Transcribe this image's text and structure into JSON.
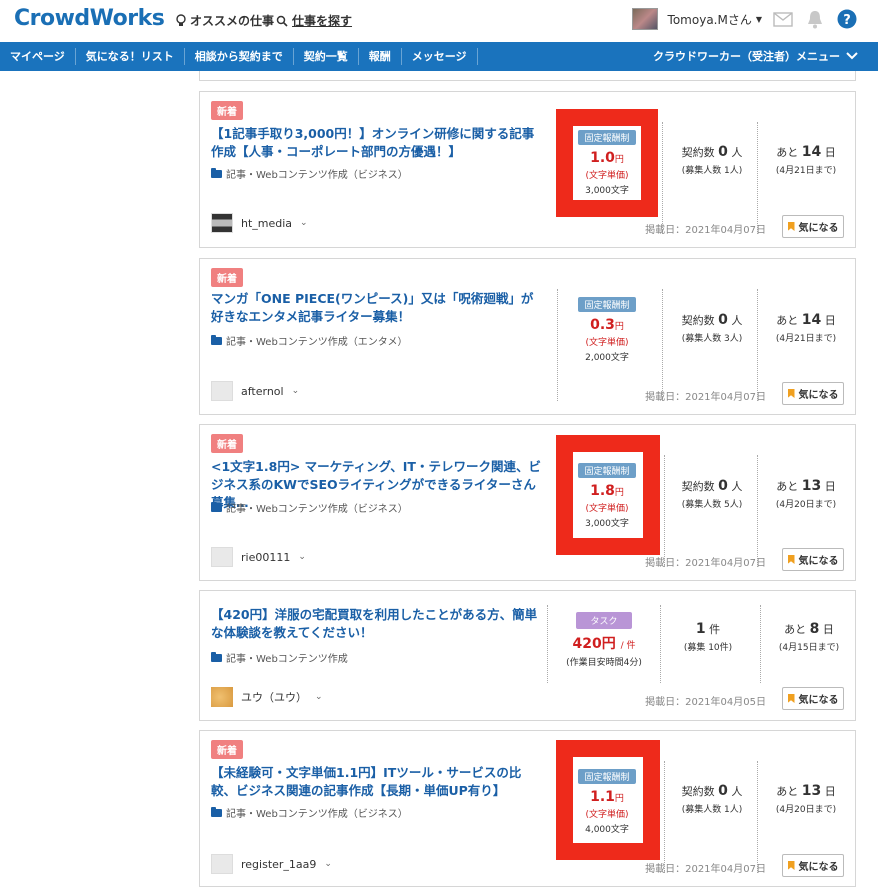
{
  "header": {
    "logo": "CrowdWorks",
    "recommend_label": "オススメの仕事",
    "search_label": "仕事を探す",
    "user_name": "Tomoya.Mさん",
    "icons": [
      "lightbulb-icon",
      "search-icon",
      "mail-icon",
      "bell-icon",
      "help-icon"
    ],
    "help_char": "?"
  },
  "nav": {
    "items": [
      "マイページ",
      "気になる！リスト",
      "相談から契約まで",
      "契約一覧",
      "報酬",
      "メッセージ"
    ],
    "menu_label": "クラウドワーカー（受注者）メニュー"
  },
  "colors": {
    "brand": "#1a6fb5",
    "nav_bg": "#1a73bd",
    "price_red": "#d01f1f",
    "highlight_red": "#ee2a1b",
    "new_badge": "#f08080"
  },
  "jobs": [
    {
      "badge": "新着",
      "title": "【1記事手取り3,000円！】オンライン研修に関する記事作成【人事・コーポレート部門の方優遇！】",
      "category": "記事・Webコンテンツ作成（ビジネス）",
      "client": "ht_media",
      "tag": "固定報酬制",
      "price": "1.0",
      "price_unit": "円",
      "unit_note": "(文字単価)",
      "chars": "3,000文字",
      "contracts_label": "契約数",
      "contracts": "0",
      "contracts_unit": "人",
      "recruit": "(募集人数 1人)",
      "remaining_label": "あと",
      "remaining": "14",
      "remaining_unit": "日",
      "deadline": "(4月21日まで)",
      "posted": "掲載日：2021年04月07日",
      "fav": "気になる"
    },
    {
      "badge": "新着",
      "title": "マンガ「ONE PIECE(ワンピース)」又は「呪術廻戦」が好きなエンタメ記事ライター募集！",
      "category": "記事・Webコンテンツ作成（エンタメ）",
      "client": "afternol",
      "tag": "固定報酬制",
      "price": "0.3",
      "price_unit": "円",
      "unit_note": "(文字単価)",
      "chars": "2,000文字",
      "contracts_label": "契約数",
      "contracts": "0",
      "contracts_unit": "人",
      "recruit": "(募集人数 3人)",
      "remaining_label": "あと",
      "remaining": "14",
      "remaining_unit": "日",
      "deadline": "(4月21日まで)",
      "posted": "掲載日：2021年04月07日",
      "fav": "気になる"
    },
    {
      "badge": "新着",
      "title": "<1文字1.8円> マーケティング、IT・テレワーク関連、ビジネス系のKWでSEOライティングができるライターさん募集…",
      "category": "記事・Webコンテンツ作成（ビジネス）",
      "client": "rie00111",
      "tag": "固定報酬制",
      "price": "1.8",
      "price_unit": "円",
      "unit_note": "(文字単価)",
      "chars": "3,000文字",
      "contracts_label": "契約数",
      "contracts": "0",
      "contracts_unit": "人",
      "recruit": "(募集人数 5人)",
      "remaining_label": "あと",
      "remaining": "13",
      "remaining_unit": "日",
      "deadline": "(4月20日まで)",
      "posted": "掲載日：2021年04月07日",
      "fav": "気になる"
    },
    {
      "title": "【420円】洋服の宅配買取を利用したことがある方、簡単な体験談を教えてください！",
      "category": "記事・Webコンテンツ作成",
      "client": "ユウ（ユウ）",
      "tag": "タスク",
      "price": "420円",
      "price_per": "/ 件",
      "unit_note": "(作業目安時間4分)",
      "count": "1",
      "count_unit": "件",
      "recruit": "(募集 10件)",
      "remaining_label": "あと",
      "remaining": "8",
      "remaining_unit": "日",
      "deadline": "(4月15日まで)",
      "posted": "掲載日：2021年04月05日",
      "fav": "気になる"
    },
    {
      "badge": "新着",
      "title": "【未経験可・文字単価1.1円】ITツール・サービスの比較、ビジネス関連の記事作成【長期・単価UP有り】",
      "category": "記事・Webコンテンツ作成（ビジネス）",
      "client": "register_1aa9",
      "tag": "固定報酬制",
      "price": "1.1",
      "price_unit": "円",
      "unit_note": "(文字単価)",
      "chars": "4,000文字",
      "contracts_label": "契約数",
      "contracts": "0",
      "contracts_unit": "人",
      "recruit": "(募集人数 1人)",
      "remaining_label": "あと",
      "remaining": "13",
      "remaining_unit": "日",
      "deadline": "(4月20日まで)",
      "posted": "掲載日：2021年04月07日",
      "fav": "気になる"
    }
  ]
}
